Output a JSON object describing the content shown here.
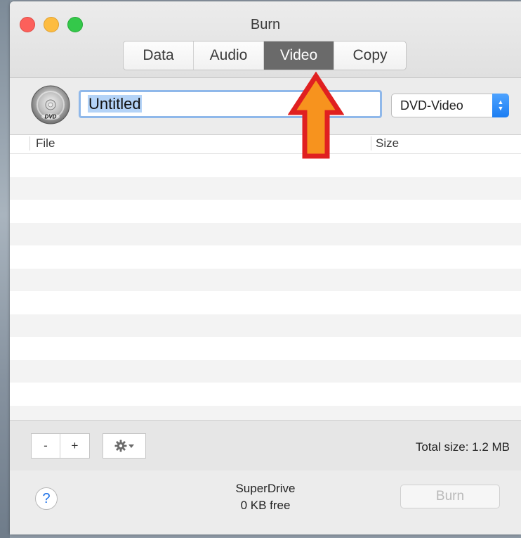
{
  "window": {
    "title": "Burn"
  },
  "tabs": [
    {
      "label": "Data",
      "active": false
    },
    {
      "label": "Audio",
      "active": false
    },
    {
      "label": "Video",
      "active": true
    },
    {
      "label": "Copy",
      "active": false
    }
  ],
  "toolbar": {
    "disc_icon_text": "DVD",
    "disc_name_value": "Untitled",
    "disc_type_selected": "DVD-Video"
  },
  "file_list": {
    "columns": [
      "File",
      "Size"
    ],
    "rows": []
  },
  "bottom_bar": {
    "remove_label": "-",
    "add_label": "+",
    "total_size": "Total size: 1.2 MB"
  },
  "footer": {
    "help_label": "?",
    "drive_name": "SuperDrive",
    "drive_free": "0 KB free",
    "burn_label": "Burn"
  },
  "icons": {
    "disc": "dvd-disc-icon",
    "actions": "gear-icon",
    "help": "question-mark-icon",
    "annotation": "up-arrow-icon"
  },
  "colors": {
    "active_tab": "#6a6a6a",
    "selection": "#b4d3f7",
    "focus_ring": "#8fb8ea",
    "select_accent": "#1b7df2",
    "annotation_fill": "#f7931e",
    "annotation_stroke": "#e02020"
  }
}
